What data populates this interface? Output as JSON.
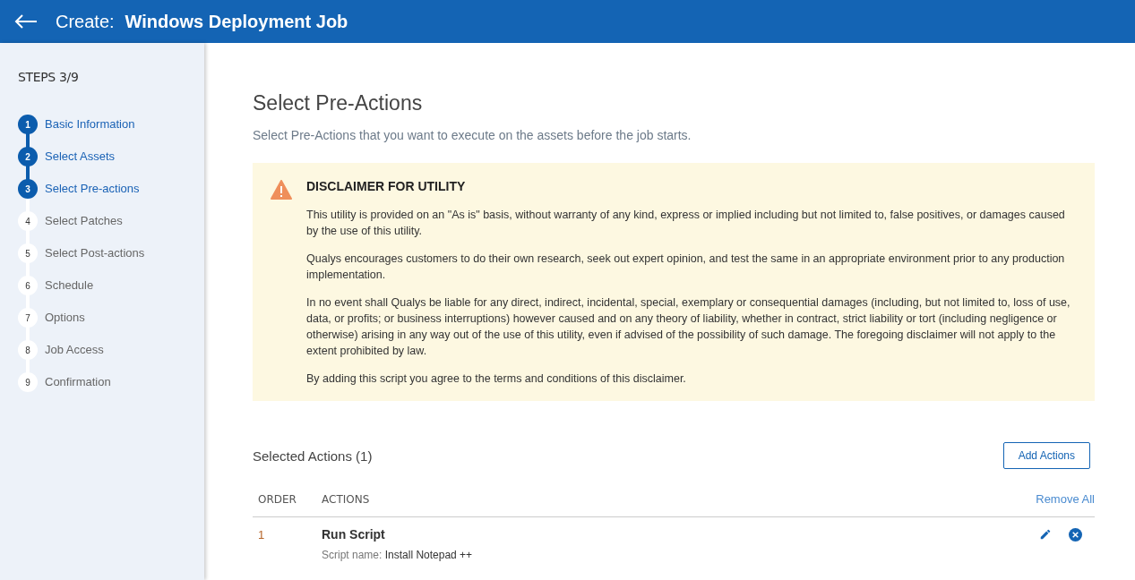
{
  "header": {
    "prefix": "Create:",
    "title": "Windows Deployment Job"
  },
  "sidebar": {
    "title": "STEPS 3/9",
    "steps": [
      {
        "number": "1",
        "label": "Basic Information",
        "done": true
      },
      {
        "number": "2",
        "label": "Select Assets",
        "done": true
      },
      {
        "number": "3",
        "label": "Select Pre-actions",
        "done": true
      },
      {
        "number": "4",
        "label": "Select Patches",
        "done": false
      },
      {
        "number": "5",
        "label": "Select Post-actions",
        "done": false
      },
      {
        "number": "6",
        "label": "Schedule",
        "done": false
      },
      {
        "number": "7",
        "label": "Options",
        "done": false
      },
      {
        "number": "8",
        "label": "Job Access",
        "done": false
      },
      {
        "number": "9",
        "label": "Confirmation",
        "done": false
      }
    ]
  },
  "page": {
    "title": "Select Pre-Actions",
    "subtitle": "Select Pre-Actions that you want to execute on the assets before the job starts."
  },
  "disclaimer": {
    "title": "DISCLAIMER FOR UTILITY",
    "paragraphs": [
      "This utility is provided on an \"As is\" basis, without warranty of any kind, express or implied including but not limited to, false positives, or damages caused by the use of this utility.",
      "Qualys encourages customers to do their own research, seek out expert opinion, and test the same in an appropriate environment prior to any production implementation.",
      "In no event shall Qualys be liable for any direct, indirect, incidental, special, exemplary or consequential damages (including, but not limited to, loss of use, data, or profits; or business interruptions) however caused and on any theory of liability, whether in contract, strict liability or tort (including negligence or otherwise) arising in any way out of the use of this utility, even if advised of the possibility of such damage. The foregoing disclaimer will not apply to the extent prohibited by law.",
      "By adding this script you agree to the terms and conditions of this disclaimer."
    ]
  },
  "actions": {
    "title": "Selected Actions (1)",
    "add_button": "Add Actions",
    "columns": [
      "ORDER",
      "ACTIONS"
    ],
    "remove_all": "Remove All",
    "rows": [
      {
        "order": "1",
        "name": "Run Script",
        "detail_label": "Script name:",
        "detail_value": "Install Notepad ++"
      }
    ]
  }
}
